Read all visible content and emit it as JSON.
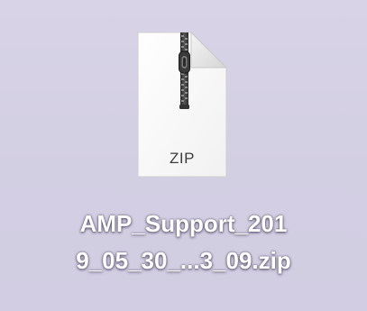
{
  "desktop": {
    "background_color": "#d5d1e4",
    "file": {
      "icon": "zip-archive-icon",
      "icon_extension_text": "ZIP",
      "name_line_1": "AMP_Support_201",
      "name_line_2": "9_05_30_...3_09.zip"
    }
  }
}
